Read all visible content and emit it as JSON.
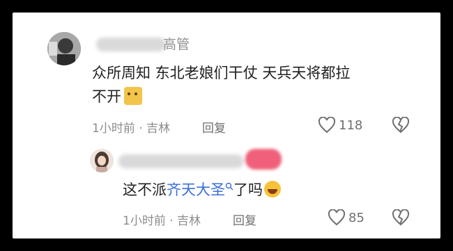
{
  "comments": [
    {
      "username_suffix": "高管",
      "text_line1": "众所周知 东北老娘们干仗 天兵天将都拉",
      "text_line2": "不开",
      "emoji": "cat-emoji",
      "time": "1小时前",
      "sep": "·",
      "location": "吉林",
      "reply_label": "回复",
      "likes": "118"
    },
    {
      "text_prefix": "这不派",
      "link_text": "齐天大圣",
      "text_suffix": "了吗",
      "emoji": "laughing-emoji",
      "time": "1小时前",
      "sep": "·",
      "location": "吉林",
      "reply_label": "回复",
      "likes": "85"
    }
  ],
  "colors": {
    "link": "#3a6fd8",
    "muted": "#8c8c8c",
    "text": "#1f1f1f"
  },
  "icons": [
    "heart-outline-icon",
    "broken-heart-icon",
    "search-icon"
  ]
}
